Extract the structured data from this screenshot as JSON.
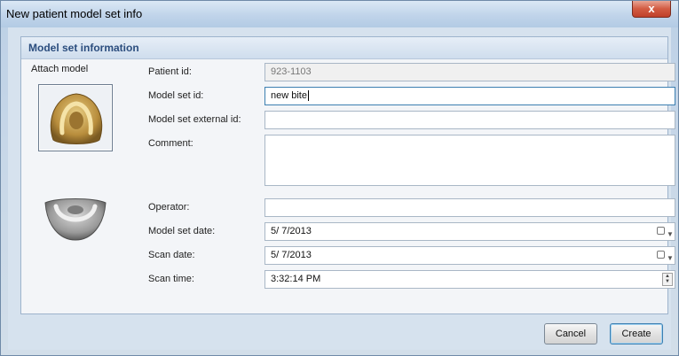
{
  "window": {
    "title": "New patient model set info",
    "close_glyph": "x"
  },
  "group": {
    "header": "Model set information",
    "attach_label": "Attach model"
  },
  "form": {
    "patient_id": {
      "label": "Patient id:",
      "value": "923-1103"
    },
    "model_set_id": {
      "label": "Model set id:",
      "value": "new bite"
    },
    "external_id": {
      "label": "Model set external id:",
      "value": ""
    },
    "comment": {
      "label": "Comment:",
      "value": ""
    },
    "operator": {
      "label": "Operator:",
      "value": ""
    },
    "model_set_date": {
      "label": "Model set date:",
      "value": "5/ 7/2013"
    },
    "scan_date": {
      "label": "Scan date:",
      "value": "5/ 7/2013"
    },
    "scan_time": {
      "label": "Scan time:",
      "value": "3:32:14 PM"
    }
  },
  "buttons": {
    "cancel": "Cancel",
    "create": "Create"
  },
  "icons": {
    "upper_model": "upper-dental-model-icon",
    "lower_model": "lower-dental-model-icon",
    "calendar": "calendar-dropdown-icon",
    "spinner": "time-spinner-icon"
  }
}
